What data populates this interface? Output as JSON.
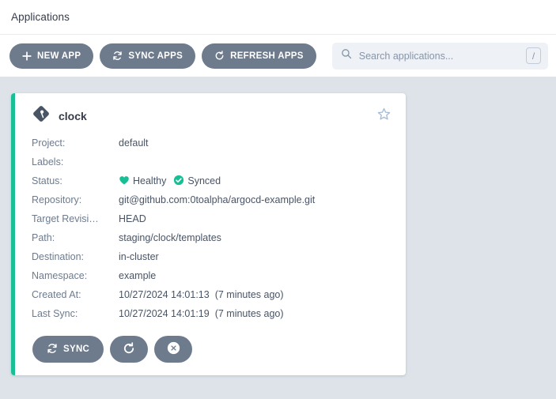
{
  "header": {
    "title": "Applications"
  },
  "toolbar": {
    "new_app_label": "NEW APP",
    "sync_apps_label": "SYNC APPS",
    "refresh_apps_label": "REFRESH APPS",
    "search_placeholder": "Search applications...",
    "search_value": "",
    "search_shortcut": "/"
  },
  "colors": {
    "page_background": "#dee3ea",
    "card_accent": "#18be94",
    "button": "#6d7b8d",
    "healthy": "#18be94",
    "synced": "#18be94",
    "text": "#363c4a",
    "label": "#6d7b8d"
  },
  "application": {
    "name": "clock",
    "favorite": false,
    "status": {
      "health_label": "Healthy",
      "health_icon": "heart-icon",
      "sync_label": "Synced",
      "sync_icon": "check-circle-icon"
    },
    "details": [
      {
        "label": "Project:",
        "value": "default"
      },
      {
        "label": "Labels:",
        "value": ""
      },
      {
        "label": "Status:",
        "value": ""
      },
      {
        "label": "Repository:",
        "value": "git@github.com:0toalpha/argocd-example.git"
      },
      {
        "label": "Target Revisi…",
        "value": "HEAD"
      },
      {
        "label": "Path:",
        "value": "staging/clock/templates"
      },
      {
        "label": "Destination:",
        "value": "in-cluster"
      },
      {
        "label": "Namespace:",
        "value": "example"
      },
      {
        "label": "Created At:",
        "value": "10/27/2024 14:01:13",
        "relative": "(7 minutes ago)"
      },
      {
        "label": "Last Sync:",
        "value": "10/27/2024 14:01:19",
        "relative": "(7 minutes ago)"
      }
    ],
    "actions": {
      "sync_label": "SYNC",
      "refresh_label": "",
      "delete_label": ""
    }
  }
}
